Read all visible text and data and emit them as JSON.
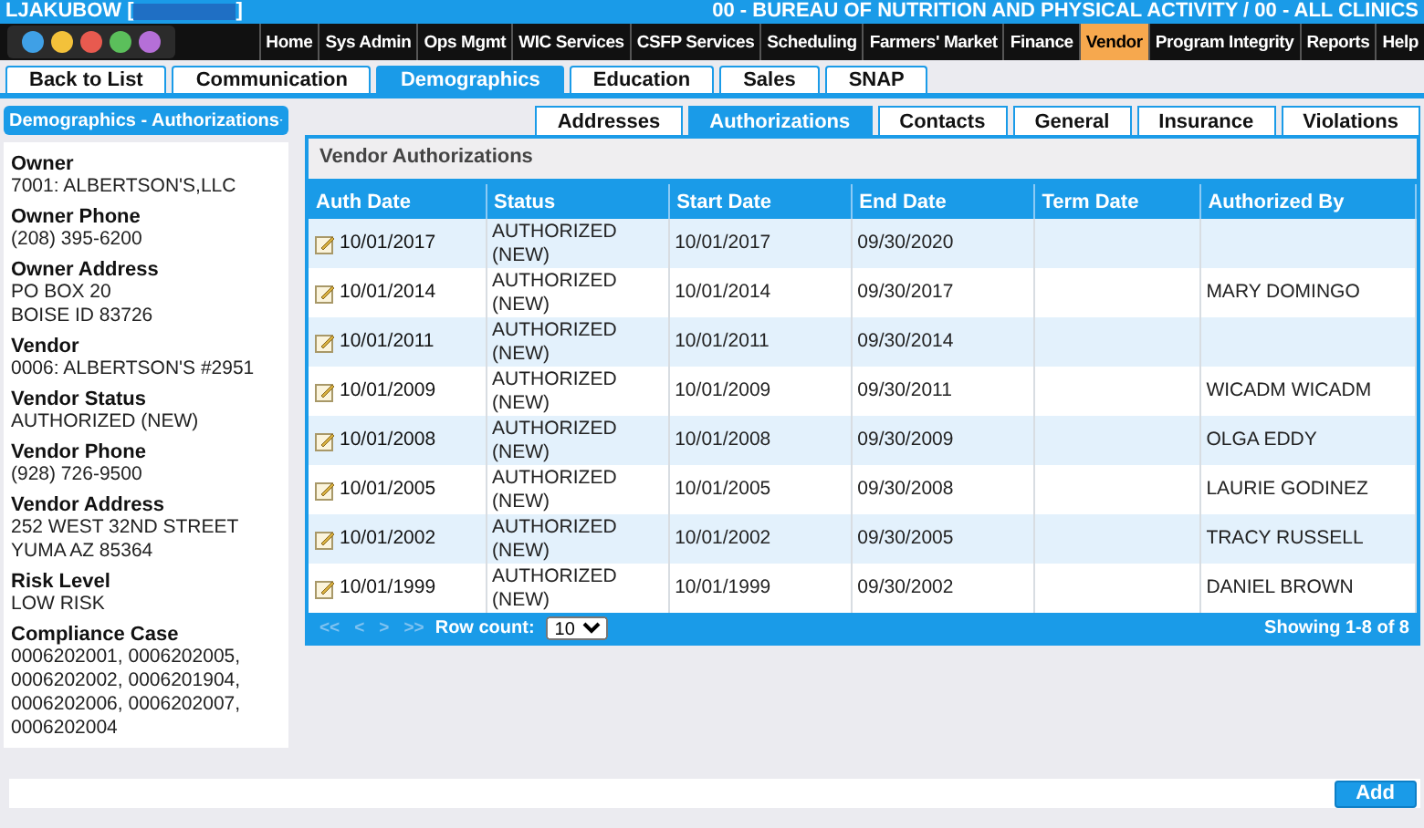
{
  "header": {
    "user": "LJAKUBOW [",
    "user_close": "]",
    "agency": "00 - BUREAU OF NUTRITION AND PHYSICAL ACTIVITY / 00 - ALL CLINICS"
  },
  "nav": [
    {
      "label": "Home",
      "selected": false
    },
    {
      "label": "Sys Admin",
      "selected": false
    },
    {
      "label": "Ops Mgmt",
      "selected": false
    },
    {
      "label": "WIC Services",
      "selected": false
    },
    {
      "label": "CSFP Services",
      "selected": false
    },
    {
      "label": "Scheduling",
      "selected": false
    },
    {
      "label": "Farmers' Market",
      "selected": false
    },
    {
      "label": "Finance",
      "selected": false
    },
    {
      "label": "Vendor",
      "selected": true
    },
    {
      "label": "Program Integrity",
      "selected": false
    },
    {
      "label": "Reports",
      "selected": false
    },
    {
      "label": "Help",
      "selected": false
    }
  ],
  "tabs": [
    {
      "label": "Back to List",
      "selected": false
    },
    {
      "label": "Communication",
      "selected": false
    },
    {
      "label": "Demographics",
      "selected": true
    },
    {
      "label": "Education",
      "selected": false
    },
    {
      "label": "Sales",
      "selected": false
    },
    {
      "label": "SNAP",
      "selected": false
    }
  ],
  "sidebar": {
    "dropdown": "Demographics - Authorizations",
    "fields": [
      {
        "label": "Owner",
        "lines": [
          "7001: ALBERTSON'S,LLC"
        ]
      },
      {
        "label": "Owner Phone",
        "lines": [
          "(208) 395-6200"
        ]
      },
      {
        "label": "Owner Address",
        "lines": [
          "PO BOX 20",
          "BOISE ID 83726"
        ]
      },
      {
        "label": "Vendor",
        "lines": [
          "0006: ALBERTSON'S #2951"
        ]
      },
      {
        "label": "Vendor Status",
        "lines": [
          "AUTHORIZED (NEW)"
        ]
      },
      {
        "label": "Vendor Phone",
        "lines": [
          "(928) 726-9500"
        ]
      },
      {
        "label": "Vendor Address",
        "lines": [
          "252 WEST 32ND STREET",
          "YUMA AZ 85364"
        ]
      },
      {
        "label": "Risk Level",
        "lines": [
          "LOW RISK"
        ]
      },
      {
        "label": "Compliance Case",
        "lines": [
          "0006202001, 0006202005,",
          "0006202002, 0006201904,",
          "0006202006, 0006202007,",
          "0006202004"
        ]
      }
    ]
  },
  "subtabs": [
    {
      "label": "Addresses",
      "selected": false
    },
    {
      "label": "Authorizations",
      "selected": true
    },
    {
      "label": "Contacts",
      "selected": false
    },
    {
      "label": "General",
      "selected": false
    },
    {
      "label": "Insurance",
      "selected": false
    },
    {
      "label": "Violations",
      "selected": false
    }
  ],
  "table": {
    "title": "Vendor Authorizations",
    "columns": [
      "Auth Date",
      "Status",
      "Start Date",
      "End Date",
      "Term Date",
      "Authorized By"
    ],
    "rows": [
      [
        "10/01/2017",
        "AUTHORIZED (NEW)",
        "10/01/2017",
        "09/30/2020",
        "",
        ""
      ],
      [
        "10/01/2014",
        "AUTHORIZED (NEW)",
        "10/01/2014",
        "09/30/2017",
        "",
        "MARY DOMINGO"
      ],
      [
        "10/01/2011",
        "AUTHORIZED (NEW)",
        "10/01/2011",
        "09/30/2014",
        "",
        ""
      ],
      [
        "10/01/2009",
        "AUTHORIZED (NEW)",
        "10/01/2009",
        "09/30/2011",
        "",
        "WICADM WICADM"
      ],
      [
        "10/01/2008",
        "AUTHORIZED (NEW)",
        "10/01/2008",
        "09/30/2009",
        "",
        "OLGA EDDY"
      ],
      [
        "10/01/2005",
        "AUTHORIZED (NEW)",
        "10/01/2005",
        "09/30/2008",
        "",
        "LAURIE GODINEZ"
      ],
      [
        "10/01/2002",
        "AUTHORIZED (NEW)",
        "10/01/2002",
        "09/30/2005",
        "",
        "TRACY RUSSELL"
      ],
      [
        "10/01/1999",
        "AUTHORIZED (NEW)",
        "10/01/1999",
        "09/30/2002",
        "",
        "DANIEL BROWN"
      ]
    ],
    "pager": [
      {
        "label": "<<",
        "disabled": true
      },
      {
        "label": "<",
        "disabled": true
      },
      {
        "label": ">",
        "disabled": true
      },
      {
        "label": ">>",
        "disabled": true
      }
    ],
    "row_count_label": "Row count:",
    "row_count": "10",
    "showing": "Showing 1-8 of 8"
  },
  "add_button": "Add"
}
